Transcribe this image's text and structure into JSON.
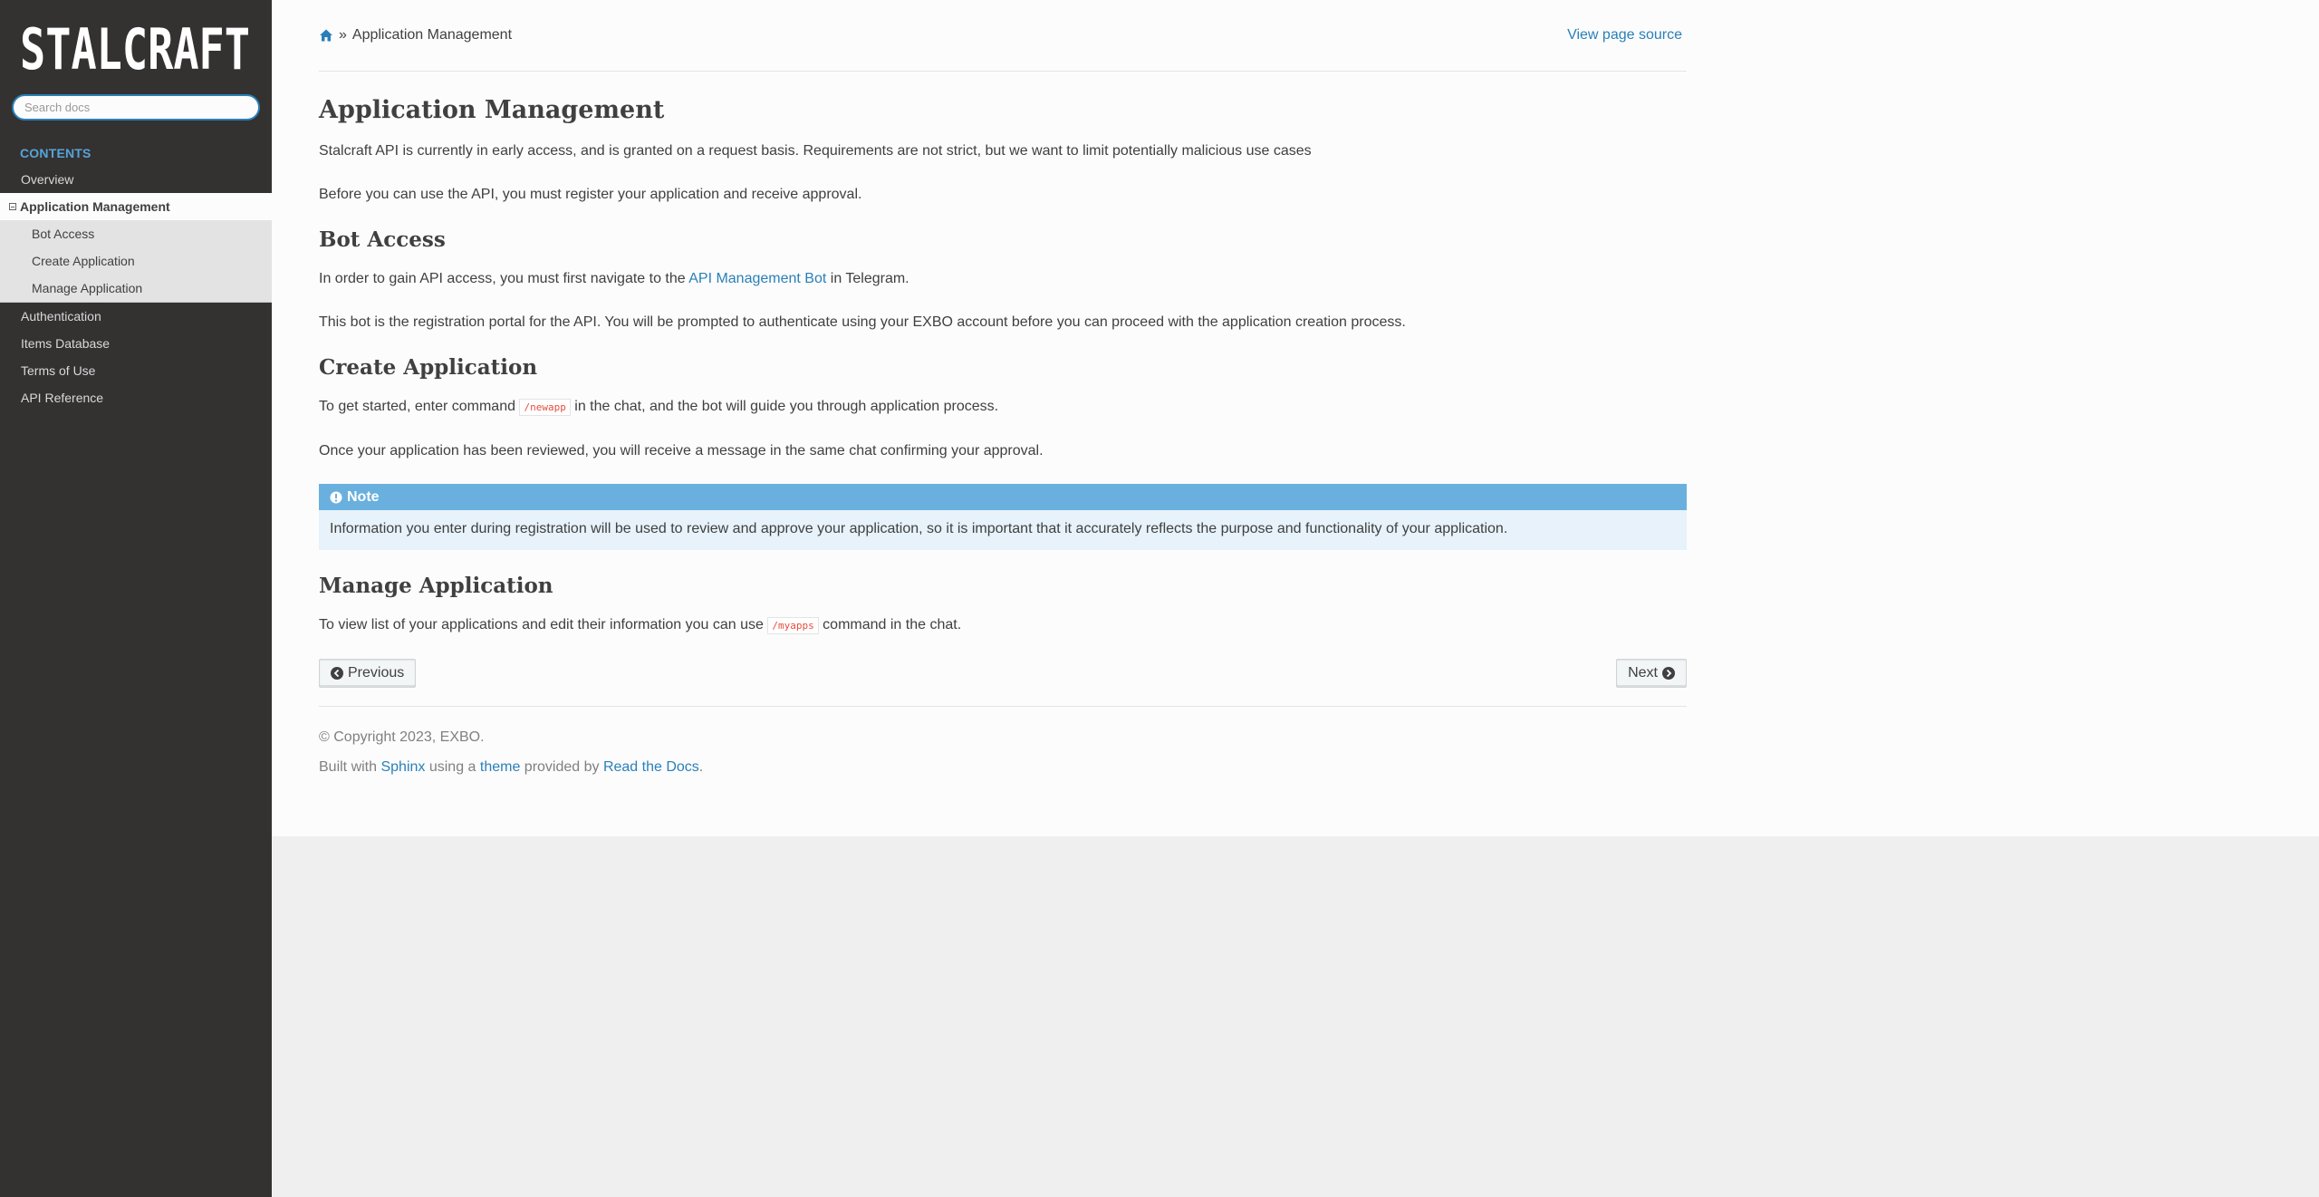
{
  "sidebar": {
    "logo_text": "STALCRAFT",
    "search_placeholder": "Search docs",
    "caption": "CONTENTS",
    "items_before": [
      {
        "label": "Overview"
      }
    ],
    "current": {
      "label": "Application Management"
    },
    "subitems": [
      {
        "label": "Bot Access"
      },
      {
        "label": "Create Application"
      },
      {
        "label": "Manage Application"
      }
    ],
    "items_after": [
      {
        "label": "Authentication"
      },
      {
        "label": "Items Database"
      },
      {
        "label": "Terms of Use"
      },
      {
        "label": "API Reference"
      }
    ]
  },
  "breadcrumbs": {
    "separator": "»",
    "current": "Application Management",
    "view_source": "View page source"
  },
  "article": {
    "title": "Application Management",
    "intro_1": "Stalcraft API is currently in early access, and is granted on a request basis. Requirements are not strict, but we want to limit potentially malicious use cases",
    "intro_2": "Before you can use the API, you must register your application and receive approval.",
    "bot_access": {
      "heading": "Bot Access",
      "p1_before": "In order to gain API access, you must first navigate to the ",
      "p1_link": "API Management Bot",
      "p1_after": " in Telegram.",
      "p2": "This bot is the registration portal for the API. You will be prompted to authenticate using your EXBO account before you can proceed with the application creation process."
    },
    "create_application": {
      "heading": "Create Application",
      "p1_before": "To get started, enter command ",
      "p1_code": "/newapp",
      "p1_after": " in the chat, and the bot will guide you through application process.",
      "p2": "Once your application has been reviewed, you will receive a message in the same chat confirming your approval."
    },
    "note": {
      "title": "Note",
      "body": "Information you enter during registration will be used to review and approve your application, so it is important that it accurately reflects the purpose and functionality of your application."
    },
    "manage_application": {
      "heading": "Manage Application",
      "p1_before": "To view list of your applications and edit their information you can use ",
      "p1_code": "/myapps",
      "p1_after": " command in the chat."
    }
  },
  "pager": {
    "previous": "Previous",
    "next": "Next"
  },
  "footer": {
    "copyright": "© Copyright 2023, EXBO.",
    "built_with": "Built with ",
    "sphinx": "Sphinx",
    "using_a": " using a ",
    "theme": "theme",
    "provided_by": " provided by ",
    "rtd": "Read the Docs",
    "period": "."
  },
  "colors": {
    "sidebar_bg": "#343131",
    "link": "#2980b9",
    "caption": "#55a5d9",
    "note_header": "#6ab0de",
    "note_body": "#e7f2fa"
  }
}
